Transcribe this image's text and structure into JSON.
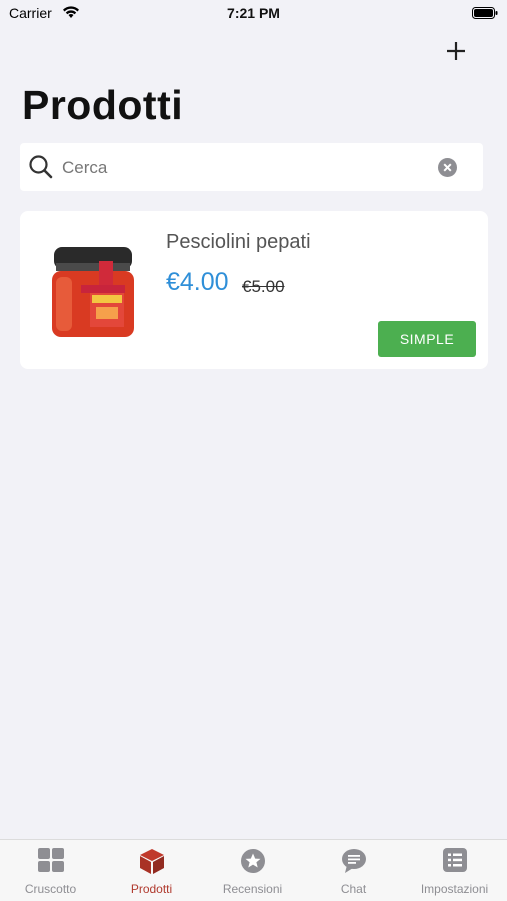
{
  "status_bar": {
    "carrier": "Carrier",
    "time": "7:21 PM"
  },
  "page": {
    "title": "Prodotti"
  },
  "search": {
    "placeholder": "Cerca"
  },
  "products": [
    {
      "name": "Pesciolini pepati",
      "price": "€4.00",
      "old_price": "€5.00",
      "type": "SIMPLE"
    }
  ],
  "tabbar": {
    "tabs": [
      {
        "label": "Cruscotto",
        "icon": "dashboard-icon",
        "active": false
      },
      {
        "label": "Prodotti",
        "icon": "box-icon",
        "active": true
      },
      {
        "label": "Recensioni",
        "icon": "star-icon",
        "active": false
      },
      {
        "label": "Chat",
        "icon": "chat-icon",
        "active": false
      },
      {
        "label": "Impostazioni",
        "icon": "list-icon",
        "active": false
      }
    ]
  },
  "colors": {
    "accent": "#b03a2e",
    "price": "#2f8fd8",
    "badge": "#4caf50",
    "background": "#f2f2f7"
  }
}
